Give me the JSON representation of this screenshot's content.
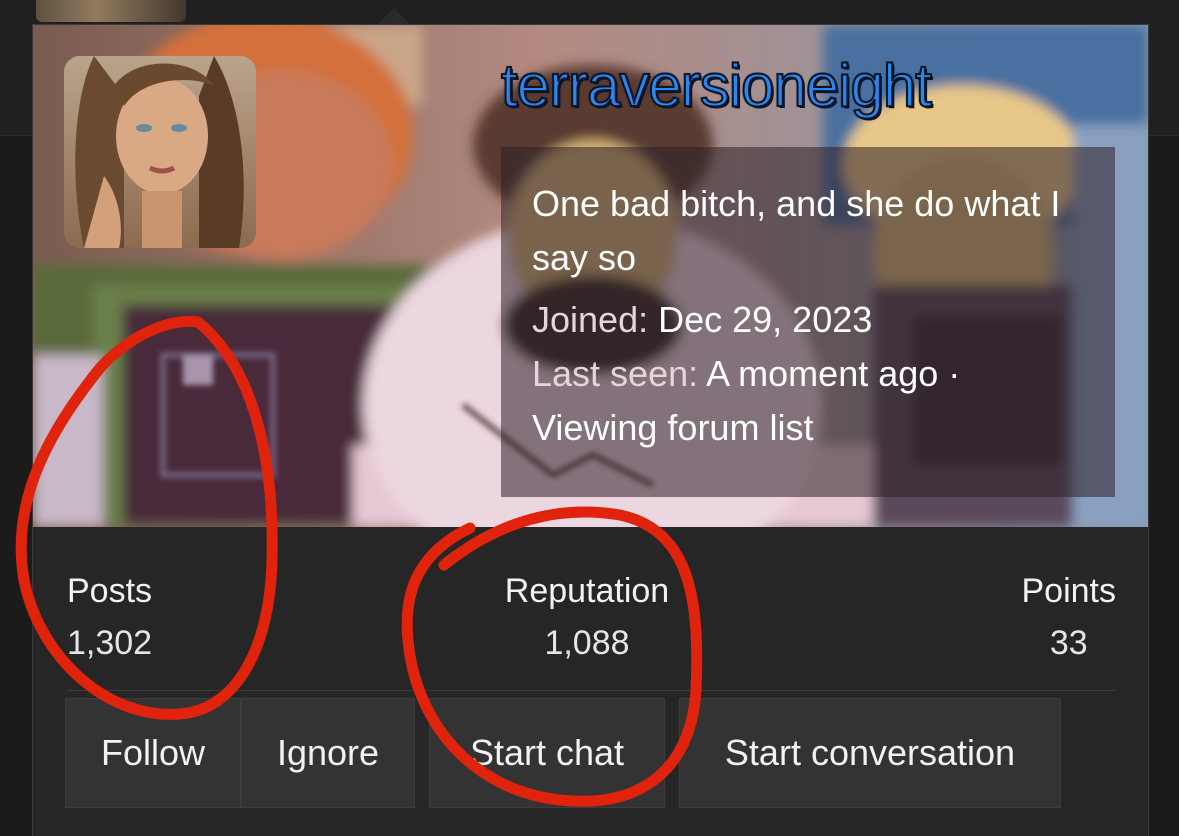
{
  "profile": {
    "username": "terraversioneight",
    "tagline": "One bad bitch, and she do what I say so",
    "joined_label": "Joined:",
    "joined_value": "Dec 29, 2023",
    "last_seen_label": "Last seen:",
    "last_seen_value": "A moment ago ·",
    "activity": "Viewing forum list"
  },
  "stats": {
    "posts_label": "Posts",
    "posts_value": "1,302",
    "reputation_label": "Reputation",
    "reputation_value": "1,088",
    "points_label": "Points",
    "points_value": "33"
  },
  "actions": {
    "follow": "Follow",
    "ignore": "Ignore",
    "start_chat": "Start chat",
    "start_conversation": "Start conversation"
  },
  "colors": {
    "username": "#2b86ee",
    "annotation": "#e0230c",
    "card_background": "#262626",
    "button_background": "#333333"
  },
  "icons": [
    "avatar-photo",
    "red-circle-annotation"
  ]
}
